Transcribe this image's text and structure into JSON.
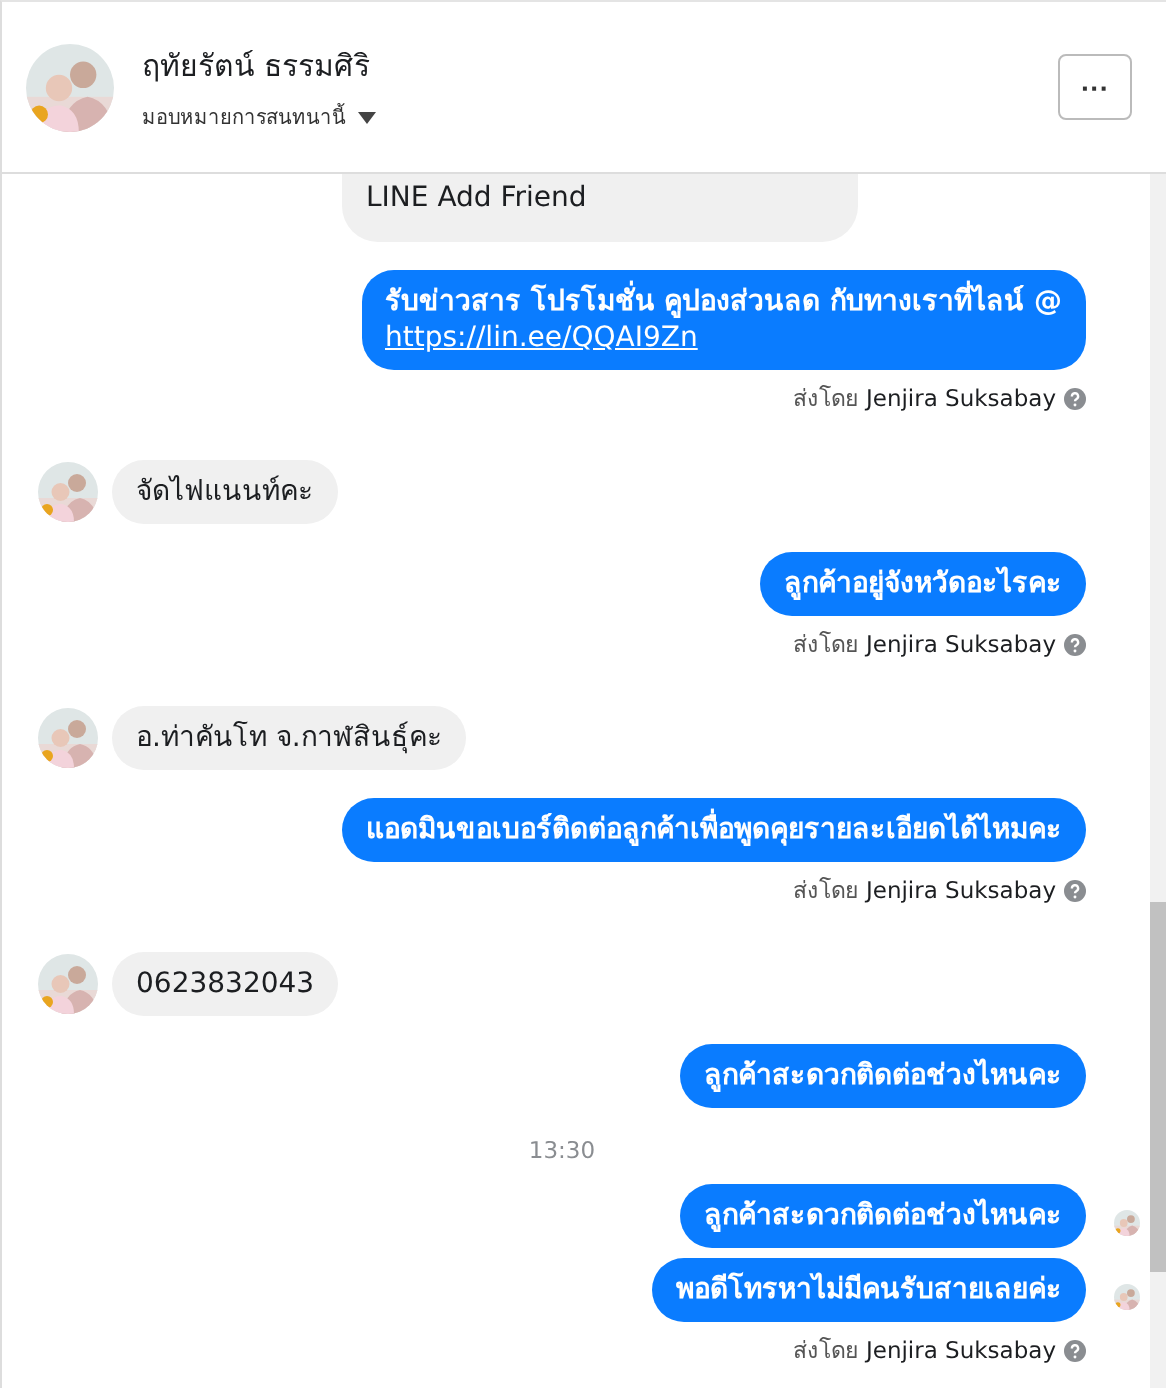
{
  "header": {
    "name": "ฤทัยรัตน์ ธรรมศิริ",
    "assign_label": "มอบหมายการสนทนานี้",
    "more_button": "···"
  },
  "messages": [
    {
      "kind": "incoming_cut",
      "text": "LINE Add Friend"
    },
    {
      "kind": "outgoing",
      "text": "รับข่าวสาร  โปรโมชั่น คูปองส่วนลด กับทางเราที่ไลน์ @",
      "link": "https://lin.ee/QQAI9Zn"
    },
    {
      "kind": "sent_by",
      "text": "ส่งโดย **Jenjira Suksabay**"
    },
    {
      "kind": "incoming",
      "text": "จัดไฟแนนท์คะ"
    },
    {
      "kind": "outgoing",
      "text": "ลูกค้าอยู่จังหวัดอะไรคะ"
    },
    {
      "kind": "sent_by",
      "text": "ส่งโดย **Jenjira Suksabay**"
    },
    {
      "kind": "incoming",
      "text": "อ.ท่าคันโท จ.กาฬสินธุ์คะ"
    },
    {
      "kind": "outgoing",
      "text": "แอดมินขอเบอร์ติดต่อลูกค้าเพื่อพูดคุยรายละเอียดได้ไหมคะ"
    },
    {
      "kind": "sent_by",
      "text": "ส่งโดย **Jenjira Suksabay**"
    },
    {
      "kind": "incoming",
      "text": "0623832043"
    },
    {
      "kind": "outgoing",
      "text": "ลูกค้าสะดวกติดต่อช่วงไหนคะ"
    },
    {
      "kind": "time",
      "text": "13:30"
    },
    {
      "kind": "outgoing",
      "text": "ลูกค้าสะดวกติดต่อช่วงไหนคะ",
      "seen": true
    },
    {
      "kind": "outgoing",
      "text": "พอดีโทรหาไม่มีคนรับสายเลยค่ะ",
      "seen": true
    },
    {
      "kind": "sent_by",
      "text": "ส่งโดย **Jenjira Suksabay**"
    }
  ]
}
